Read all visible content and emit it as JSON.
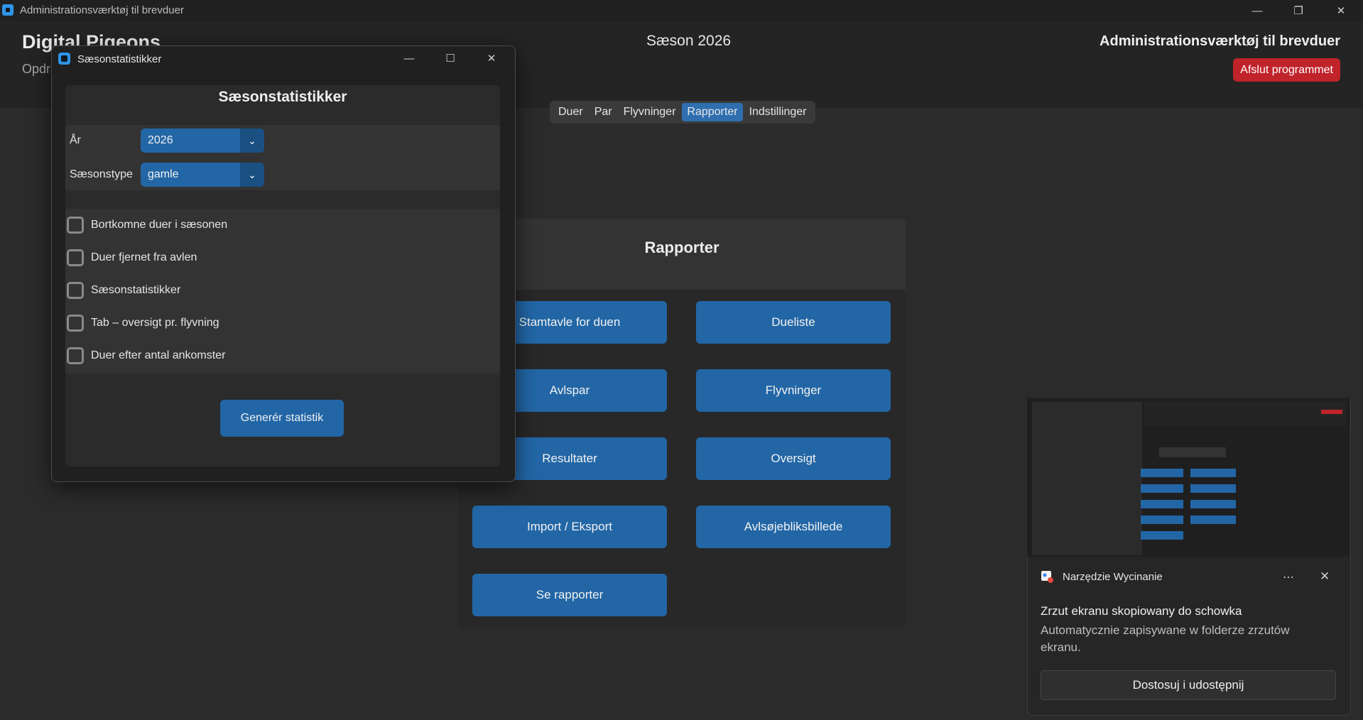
{
  "window": {
    "title": "Administrationsværktøj til brevduer",
    "controls": [
      "minimize",
      "restore",
      "close"
    ]
  },
  "header": {
    "brand": "Digital Pigeons",
    "subtitle": "Opdra",
    "season": "Sæson 2026",
    "app_title": "Administrationsværktøj til brevduer",
    "quit_label": "Afslut programmet"
  },
  "nav": {
    "items": [
      "Duer",
      "Par",
      "Flyvninger",
      "Rapporter",
      "Indstillinger"
    ],
    "active": "Rapporter"
  },
  "reports": {
    "title": "Rapporter",
    "buttons": [
      "Stamtavle for duen",
      "Dueliste",
      "Avlspar",
      "Flyvninger",
      "Resultater",
      "Oversigt",
      "Import / Eksport",
      "Avlsøjebliksbillede",
      "Se rapporter"
    ]
  },
  "dialog": {
    "window_title": "Sæsonstatistikker",
    "heading": "Sæsonstatistikker",
    "year_label": "År",
    "year_value": "2026",
    "season_type_label": "Sæsonstype",
    "season_type_value": "gamle",
    "checkboxes": [
      {
        "label": "Bortkomne duer i sæsonen",
        "checked": false
      },
      {
        "label": "Duer fjernet fra avlen",
        "checked": false
      },
      {
        "label": "Sæsonstatistikker",
        "checked": false
      },
      {
        "label": "Tab – oversigt pr. flyvning",
        "checked": false
      },
      {
        "label": "Duer efter antal ankomster",
        "checked": false
      }
    ],
    "generate_label": "Generér statistik"
  },
  "notification": {
    "app_name": "Narzędzie Wycinanie",
    "title": "Zrzut ekranu skopiowany do schowka",
    "message": "Automatycznie zapisywane w folderze zrzutów ekranu.",
    "action_label": "Dostosuj i udostępnij"
  }
}
